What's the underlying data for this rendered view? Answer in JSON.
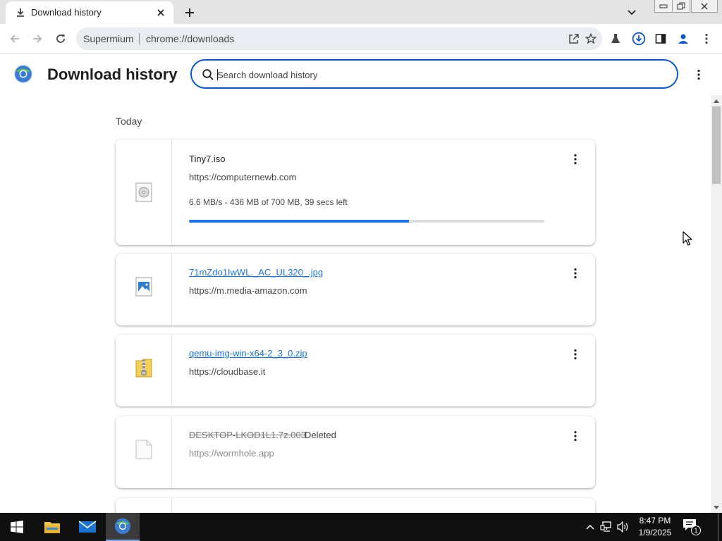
{
  "tab": {
    "title": "Download history"
  },
  "omnibox": {
    "site_label": "Supermium",
    "url": "chrome://downloads"
  },
  "header": {
    "title": "Download history",
    "search_placeholder": "Search download history",
    "search_value": ""
  },
  "downloads": {
    "date_label": "Today",
    "items": [
      {
        "filename": "Tiny7.iso",
        "url": "https://computernewb.com",
        "status": "6.6 MB/s - 436 MB of 700 MB, 39 secs left",
        "progress_fraction": 0.62,
        "state": "in_progress",
        "icon": "disc-image-icon"
      },
      {
        "filename": "71mZdo1IwWL._AC_UL320_.jpg",
        "url": "https://m.media-amazon.com",
        "state": "complete",
        "icon": "image-file-icon"
      },
      {
        "filename": "qemu-img-win-x64-2_3_0.zip",
        "url": "https://cloudbase.it",
        "state": "complete",
        "icon": "zip-archive-icon"
      },
      {
        "filename": "DESKTOP-LKOD1L1.7z.003",
        "deleted_label": "Deleted",
        "url": "https://wormhole.app",
        "state": "deleted",
        "icon": "blank-file-icon"
      }
    ]
  },
  "taskbar": {
    "time": "8:47 PM",
    "date": "1/9/2025",
    "notification_count": "1"
  },
  "colors": {
    "accent": "#1a73e8",
    "search_border": "#0b57d0",
    "progress_track": "#dcdcdc",
    "taskbar": "#101010"
  }
}
